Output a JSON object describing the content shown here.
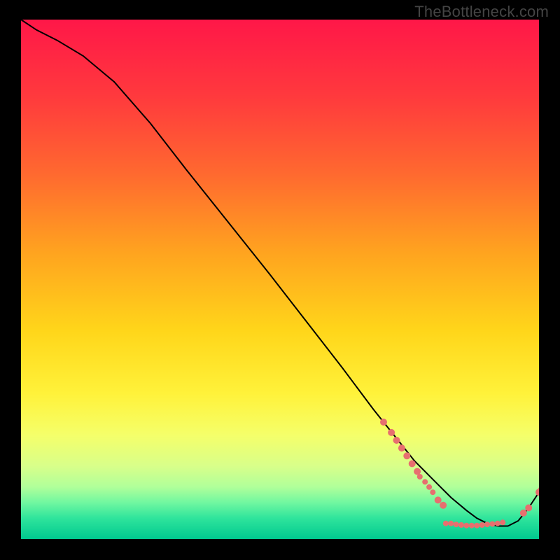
{
  "watermark": "TheBottleneck.com",
  "chart_data": {
    "type": "line",
    "title": "",
    "xlabel": "",
    "ylabel": "",
    "xlim": [
      0,
      100
    ],
    "ylim": [
      0,
      100
    ],
    "grid": false,
    "series": [
      {
        "name": "curve",
        "x": [
          0,
          3,
          7,
          12,
          18,
          25,
          32,
          40,
          48,
          55,
          62,
          68,
          72,
          76,
          80,
          83,
          86,
          88,
          90,
          92,
          94,
          96,
          98,
          100
        ],
        "y": [
          100,
          98,
          96,
          93,
          88,
          80,
          71,
          61,
          51,
          42,
          33,
          25,
          20,
          15,
          11,
          8,
          5.5,
          4,
          3,
          2.5,
          2.5,
          3.5,
          6,
          9
        ]
      }
    ],
    "highlight_points": {
      "name": "dots",
      "color": "#e76f6f",
      "points": [
        {
          "x": 70.0,
          "y": 22.5,
          "r": 5
        },
        {
          "x": 71.5,
          "y": 20.5,
          "r": 5
        },
        {
          "x": 72.5,
          "y": 19.0,
          "r": 5
        },
        {
          "x": 73.5,
          "y": 17.5,
          "r": 5
        },
        {
          "x": 74.5,
          "y": 16.0,
          "r": 5
        },
        {
          "x": 75.5,
          "y": 14.5,
          "r": 5
        },
        {
          "x": 76.5,
          "y": 13.0,
          "r": 5
        },
        {
          "x": 77.0,
          "y": 12.0,
          "r": 4
        },
        {
          "x": 78.0,
          "y": 11.0,
          "r": 4
        },
        {
          "x": 78.8,
          "y": 10.0,
          "r": 4
        },
        {
          "x": 79.5,
          "y": 9.0,
          "r": 4
        },
        {
          "x": 80.5,
          "y": 7.5,
          "r": 5
        },
        {
          "x": 81.5,
          "y": 6.5,
          "r": 5
        },
        {
          "x": 82.0,
          "y": 3.0,
          "r": 4
        },
        {
          "x": 83.0,
          "y": 3.0,
          "r": 4
        },
        {
          "x": 84.0,
          "y": 2.8,
          "r": 4
        },
        {
          "x": 85.0,
          "y": 2.7,
          "r": 4
        },
        {
          "x": 86.0,
          "y": 2.6,
          "r": 4
        },
        {
          "x": 87.0,
          "y": 2.6,
          "r": 4
        },
        {
          "x": 88.0,
          "y": 2.6,
          "r": 4
        },
        {
          "x": 89.0,
          "y": 2.7,
          "r": 4
        },
        {
          "x": 90.0,
          "y": 2.8,
          "r": 4
        },
        {
          "x": 91.0,
          "y": 2.9,
          "r": 4
        },
        {
          "x": 92.0,
          "y": 3.0,
          "r": 4
        },
        {
          "x": 93.0,
          "y": 3.2,
          "r": 4
        },
        {
          "x": 97.0,
          "y": 5.0,
          "r": 5
        },
        {
          "x": 98.0,
          "y": 6.0,
          "r": 5
        },
        {
          "x": 100.0,
          "y": 9.0,
          "r": 5
        },
        {
          "x": 100.5,
          "y": 9.5,
          "r": 5
        }
      ]
    },
    "gradient_bands": [
      {
        "offset": 0.0,
        "color": "#ff1748"
      },
      {
        "offset": 0.15,
        "color": "#ff3a3d"
      },
      {
        "offset": 0.3,
        "color": "#ff6a2f"
      },
      {
        "offset": 0.45,
        "color": "#ffa41f"
      },
      {
        "offset": 0.6,
        "color": "#ffd61a"
      },
      {
        "offset": 0.72,
        "color": "#fff23a"
      },
      {
        "offset": 0.8,
        "color": "#f5ff6a"
      },
      {
        "offset": 0.86,
        "color": "#d8ff8a"
      },
      {
        "offset": 0.9,
        "color": "#b0ff9a"
      },
      {
        "offset": 0.93,
        "color": "#70f7a0"
      },
      {
        "offset": 0.96,
        "color": "#2fe49c"
      },
      {
        "offset": 1.0,
        "color": "#00c98f"
      }
    ]
  }
}
